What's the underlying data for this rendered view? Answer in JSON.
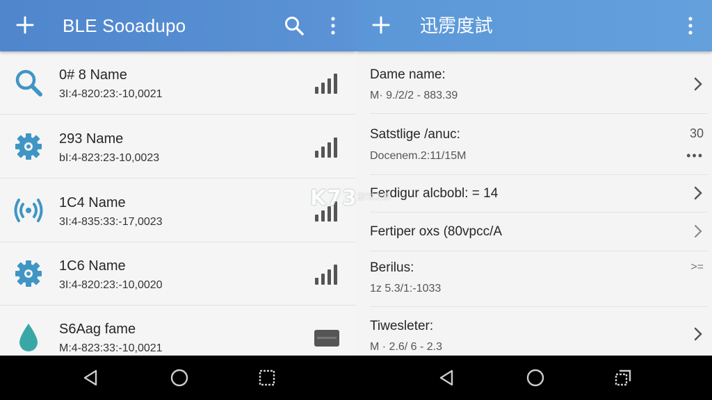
{
  "left": {
    "title": "BLE Sooadupo",
    "devices": [
      {
        "name": "0# 8 Name",
        "address": "3I:4-820:23:-10,0021",
        "icon": "search-icon"
      },
      {
        "name": "293 Name",
        "address": "bI:4-823:23-10,0023",
        "icon": "gear-icon"
      },
      {
        "name": "1C4 Name",
        "address": "3I:4-835:33:-17,0023",
        "icon": "broadcast-icon"
      },
      {
        "name": "1C6 Name",
        "address": "3I:4-820:23:-10,0020",
        "icon": "gear-icon"
      },
      {
        "name": "S6Aag fame",
        "address": "M:4-823:33:-10,0021",
        "icon": "droplet-icon"
      }
    ]
  },
  "right": {
    "title": "迅雳度試",
    "details": [
      {
        "label": "Dame name:",
        "value": "M· 9./2/2 - 883.39",
        "trail": ""
      },
      {
        "label": "Satstlige /anuc:",
        "value": "Docenem.2:11/15M",
        "trail": "30",
        "trail2": "•••"
      },
      {
        "label": "Ferdigur alcbobl: = 14",
        "value": "",
        "trail": ""
      },
      {
        "label": "Fertiper oxs (80vpcc/A",
        "value": "",
        "trail": ""
      },
      {
        "label": "Berilus:",
        "value": "1z 5.3/1:-1033",
        "trail": ">="
      },
      {
        "label": "Tiwesleter:",
        "value": "M · 2.6/ 6 - 2.3",
        "trail": ""
      }
    ]
  },
  "watermark": {
    "main": "K73",
    "sub": "游戏之家"
  },
  "colors": {
    "appbar": "#5b93d6",
    "icon": "#3f96c4",
    "signal": "#555555"
  }
}
